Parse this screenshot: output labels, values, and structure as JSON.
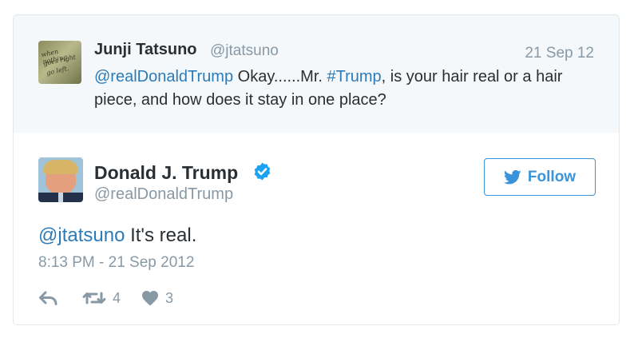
{
  "quoted_tweet": {
    "author_name": "Junji Tatsuno",
    "author_handle": "@jtatsuno",
    "date": "21 Sep 12",
    "mention": "@realDonaldTrump",
    "text_part1": " Okay......Mr. ",
    "hashtag": "#Trump",
    "text_part2": ", is your hair real or a hair piece, and how does it stay in one place?",
    "avatar_icon": "handwritten-note-avatar"
  },
  "tweet": {
    "author_name": "Donald J. Trump",
    "author_handle": "@realDonaldTrump",
    "verified_icon": "verified-badge-icon",
    "follow_label": "Follow",
    "follow_icon": "twitter-bird-icon",
    "mention": "@jtatsuno",
    "text": " It's real.",
    "timestamp": "8:13 PM - 21 Sep 2012",
    "retweet_count": "4",
    "like_count": "3"
  },
  "colors": {
    "link": "#2b7bb9",
    "accent": "#3b94d9",
    "muted": "#8899a6",
    "text": "#292f33",
    "quoted_bg": "#f5f8fa",
    "border": "#e1e8ed"
  }
}
